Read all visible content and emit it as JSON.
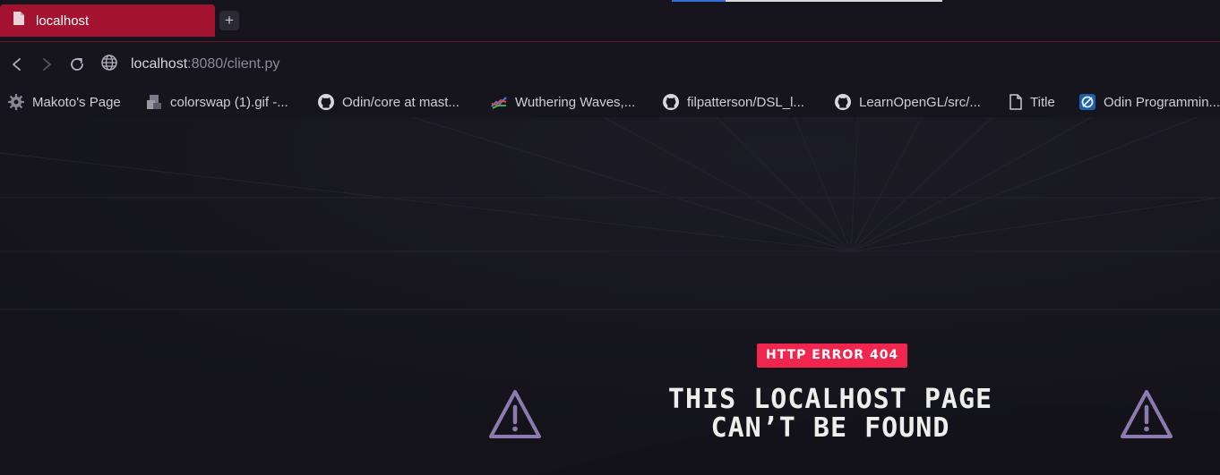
{
  "browser": {
    "tab": {
      "title": "localhost",
      "icon": "file-icon"
    },
    "new_tab_label": "+",
    "address": {
      "host": "localhost",
      "path": ":8080/client.py"
    }
  },
  "bookmarks": [
    {
      "label": "Makoto's Page",
      "icon": "bookmark-favicon-makoto"
    },
    {
      "label": "colorswap (1).gif -...",
      "icon": "gif-favicon"
    },
    {
      "label": "Odin/core at mast...",
      "icon": "github-icon"
    },
    {
      "label": "Wuthering Waves,...",
      "icon": "chart-favicon"
    },
    {
      "label": "filpatterson/DSL_l...",
      "icon": "github-icon"
    },
    {
      "label": "LearnOpenGL/src/...",
      "icon": "github-icon"
    },
    {
      "label": "Title",
      "icon": "file-icon"
    },
    {
      "label": "Odin Programmin...",
      "icon": "odin-favicon"
    }
  ],
  "page": {
    "badge": "HTTP ERROR 404",
    "headline_line1": "THIS LOCALHOST PAGE",
    "headline_line2": "CAN’T BE FOUND",
    "icon": "warning-icon"
  },
  "colors": {
    "accent": "#f0264f",
    "tab_active": "#a3132f",
    "background": "#16151d",
    "warning_icon": "#8a7bb0"
  }
}
